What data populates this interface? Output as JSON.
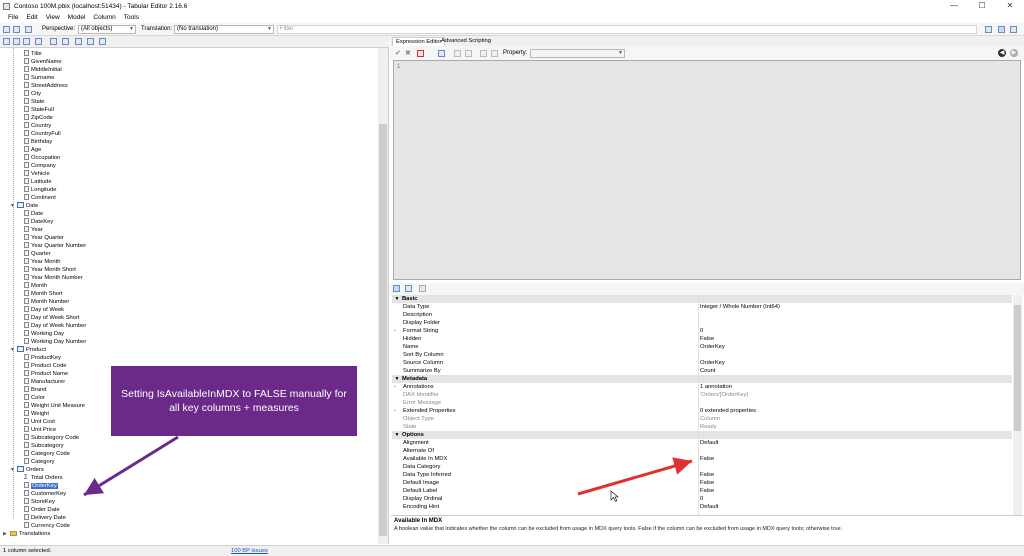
{
  "window": {
    "title": "Contoso 100M.pbix (localhost:51434) - Tabular Editor 2.16.6",
    "controls": [
      "—",
      "☐",
      "✕"
    ]
  },
  "menu": [
    "File",
    "Edit",
    "View",
    "Model",
    "Column",
    "Tools"
  ],
  "toolbar": {
    "perspective_label": "Perspective:",
    "perspective_value": "(All objects)",
    "translation_label": "Translation:",
    "translation_value": "(No translation)",
    "filter_placeholder": "Filter"
  },
  "tree": {
    "customer_columns": [
      "Title",
      "GivenName",
      "MiddleInitial",
      "Surname",
      "StreetAddress",
      "City",
      "State",
      "StateFull",
      "ZipCode",
      "Country",
      "CountryFull",
      "Birthday",
      "Age",
      "Occupation",
      "Company",
      "Vehicle",
      "Latitude",
      "Longitude",
      "Continent"
    ],
    "date_table": "Date",
    "date_columns": [
      "Date",
      "DateKey",
      "Year",
      "Year Quarter",
      "Year Quarter Number",
      "Quarter",
      "Year Month",
      "Year Month Short",
      "Year Month Number",
      "Month",
      "Month Short",
      "Month Number",
      "Day of Week",
      "Day of Week Short",
      "Day of Week Number",
      "Working Day",
      "Working Day Number"
    ],
    "product_table": "Product",
    "product_columns": [
      "ProductKey",
      "Product Code",
      "Product Name",
      "Manufacturer",
      "Brand",
      "Color",
      "Weight Unit Measure",
      "Weight",
      "Unit Cost",
      "Unit Price",
      "Subcategory Code",
      "Subcategory",
      "Category Code",
      "Category"
    ],
    "orders_table": "Orders",
    "orders_measure": "Total Orders",
    "orders_columns": [
      "OrderKey",
      "CustomerKey",
      "StoreKey",
      "Order Date",
      "Delivery Date",
      "Currency Code"
    ],
    "selected": "OrderKey",
    "translations": "Translations"
  },
  "tabs": [
    "Expression Editor",
    "Advanced Scripting"
  ],
  "expression": {
    "property_label": "Property:",
    "line_number": "1"
  },
  "properties": {
    "categories": [
      {
        "name": "Basic",
        "rows": [
          {
            "name": "Data Type",
            "value": "Integer / Whole Number (Int64)"
          },
          {
            "name": "Description",
            "value": ""
          },
          {
            "name": "Display Folder",
            "value": ""
          },
          {
            "name": "Format String",
            "value": "0",
            "expand": true
          },
          {
            "name": "Hidden",
            "value": "False"
          },
          {
            "name": "Name",
            "value": "OrderKey"
          },
          {
            "name": "Sort By Column",
            "value": ""
          },
          {
            "name": "Source Column",
            "value": "OrderKey"
          },
          {
            "name": "Summarize By",
            "value": "Count"
          }
        ]
      },
      {
        "name": "Metadata",
        "rows": [
          {
            "name": "Annotations",
            "value": "1 annotation",
            "expand": true
          },
          {
            "name": "DAX Identifier",
            "value": "'Orders'[OrderKey]",
            "ro": true
          },
          {
            "name": "Error Message",
            "value": "",
            "ro": true
          },
          {
            "name": "Extended Properties",
            "value": "0 extended properties",
            "expand": true
          },
          {
            "name": "Object Type",
            "value": "Column",
            "ro": true
          },
          {
            "name": "State",
            "value": "Ready",
            "ro": true
          }
        ]
      },
      {
        "name": "Options",
        "rows": [
          {
            "name": "Alignment",
            "value": "Default"
          },
          {
            "name": "Alternate Of",
            "value": ""
          },
          {
            "name": "Available In MDX",
            "value": "False"
          },
          {
            "name": "Data Category",
            "value": ""
          },
          {
            "name": "Data Type Inferred",
            "value": "False"
          },
          {
            "name": "Default Image",
            "value": "False"
          },
          {
            "name": "Default Label",
            "value": "False"
          },
          {
            "name": "Display Ordinal",
            "value": "0"
          },
          {
            "name": "Encoding Hint",
            "value": "Default"
          }
        ]
      }
    ]
  },
  "description": {
    "title": "Available In MDX",
    "text": "A boolean value that indicates whether the column can be excluded from usage in MDX query tools. False if the column can be excluded from usage in MDX query tools; otherwise true."
  },
  "status": {
    "left": "1 column selected.",
    "bpa": "100 BP issues"
  },
  "callout": {
    "text": "Setting IsAvailableInMDX to FALSE manually for all key columns + measures",
    "color": "#6b2a8a"
  },
  "colors": {
    "selection": "#3f6ec7",
    "arrow_red": "#e03030",
    "arrow_purple": "#6b2a8a"
  }
}
